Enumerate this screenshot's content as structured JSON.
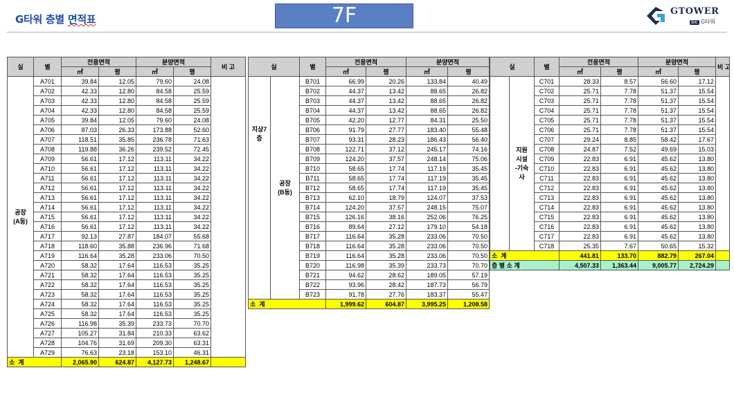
{
  "header": {
    "title_part1": "G타워 층별 ",
    "title_part2": "면적표",
    "floor": "7F",
    "logo_brand": "GTOWER",
    "logo_badge": "BIE",
    "logo_sub": "G타워"
  },
  "columns": {
    "room": "실",
    "unit": "별",
    "exclusive": "전용면적",
    "sale": "분양면적",
    "m2": "㎡",
    "pyeong": "평",
    "remark": "비 고"
  },
  "table_a": {
    "group": "공장\n(A동)",
    "rows": [
      [
        "A701",
        "39.84",
        "12.05",
        "79.60",
        "24.08"
      ],
      [
        "A702",
        "42.33",
        "12.80",
        "84.58",
        "25.59"
      ],
      [
        "A703",
        "42.33",
        "12.80",
        "84.58",
        "25.59"
      ],
      [
        "A704",
        "42.33",
        "12.80",
        "84.58",
        "25.59"
      ],
      [
        "A705",
        "39.84",
        "12.05",
        "79.60",
        "24.08"
      ],
      [
        "A706",
        "87.03",
        "26.33",
        "173.88",
        "52.60"
      ],
      [
        "A707",
        "118.51",
        "35.85",
        "236.78",
        "71.63"
      ],
      [
        "A708",
        "119.88",
        "36.26",
        "239.52",
        "72.45"
      ],
      [
        "A709",
        "56.61",
        "17.12",
        "113.11",
        "34.22"
      ],
      [
        "A710",
        "56.61",
        "17.12",
        "113.11",
        "34.22"
      ],
      [
        "A711",
        "56.61",
        "17.12",
        "113.11",
        "34.22"
      ],
      [
        "A712",
        "56.61",
        "17.12",
        "113.11",
        "34.22"
      ],
      [
        "A713",
        "56.61",
        "17.12",
        "113.11",
        "34.22"
      ],
      [
        "A714",
        "56.61",
        "17.12",
        "113.11",
        "34.22"
      ],
      [
        "A715",
        "56.61",
        "17.12",
        "113.11",
        "34.22"
      ],
      [
        "A716",
        "56.61",
        "17.12",
        "113.11",
        "34.22"
      ],
      [
        "A717",
        "92.13",
        "27.87",
        "184.07",
        "55.68"
      ],
      [
        "A718",
        "118.60",
        "35.88",
        "236.96",
        "71.68"
      ],
      [
        "A719",
        "116.64",
        "35.28",
        "233.06",
        "70.50"
      ],
      [
        "A720",
        "58.32",
        "17.64",
        "116.53",
        "35.25"
      ],
      [
        "A721",
        "58.32",
        "17.64",
        "116.53",
        "35.25"
      ],
      [
        "A722",
        "58.32",
        "17.64",
        "116.53",
        "35.25"
      ],
      [
        "A723",
        "58.32",
        "17.64",
        "116.53",
        "35.25"
      ],
      [
        "A724",
        "58.32",
        "17.64",
        "116.53",
        "35.25"
      ],
      [
        "A725",
        "58.32",
        "17.64",
        "116.53",
        "35.25"
      ],
      [
        "A726",
        "116.98",
        "35.39",
        "233.73",
        "70.70"
      ],
      [
        "A727",
        "105.27",
        "31.84",
        "210.33",
        "63.62"
      ],
      [
        "A728",
        "104.76",
        "31.69",
        "209.30",
        "63.31"
      ],
      [
        "A729",
        "76.63",
        "23.18",
        "153.10",
        "46.31"
      ]
    ],
    "subtotal_label": "소  계",
    "subtotal": [
      "2,065.90",
      "624.87",
      "4,127.73",
      "1,248.67"
    ]
  },
  "table_b": {
    "floor_label": "지상7\n층",
    "group": "공장\n(B동)",
    "rows": [
      [
        "B701",
        "66.99",
        "20.26",
        "133.84",
        "40.49"
      ],
      [
        "B702",
        "44.37",
        "13.42",
        "88.65",
        "26.82"
      ],
      [
        "B703",
        "44.37",
        "13.42",
        "88.65",
        "26.82"
      ],
      [
        "B704",
        "44.37",
        "13.42",
        "88.65",
        "26.82"
      ],
      [
        "B705",
        "42.20",
        "12.77",
        "84.31",
        "25.50"
      ],
      [
        "B706",
        "91.79",
        "27.77",
        "183.40",
        "55.48"
      ],
      [
        "B707",
        "93.31",
        "28.23",
        "186.43",
        "56.40"
      ],
      [
        "B708",
        "122.71",
        "37.12",
        "245.17",
        "74.16"
      ],
      [
        "B709",
        "124.20",
        "37.57",
        "248.14",
        "75.06"
      ],
      [
        "B710",
        "58.65",
        "17.74",
        "117.19",
        "35.45"
      ],
      [
        "B711",
        "58.65",
        "17.74",
        "117.19",
        "35.45"
      ],
      [
        "B712",
        "58.65",
        "17.74",
        "117.19",
        "35.45"
      ],
      [
        "B713",
        "62.10",
        "18.79",
        "124.07",
        "37.53"
      ],
      [
        "B714",
        "124.20",
        "37.57",
        "248.15",
        "75.07"
      ],
      [
        "B715",
        "126.16",
        "38.16",
        "252.06",
        "76.25"
      ],
      [
        "B716",
        "89.64",
        "27.12",
        "179.10",
        "54.18"
      ],
      [
        "B717",
        "116.64",
        "35.28",
        "233.06",
        "70.50"
      ],
      [
        "B718",
        "116.64",
        "35.28",
        "233.06",
        "70.50"
      ],
      [
        "B719",
        "116.64",
        "35.28",
        "233.06",
        "70.50"
      ],
      [
        "B720",
        "116.98",
        "35.39",
        "233.73",
        "70.70"
      ],
      [
        "B721",
        "94.62",
        "28.62",
        "189.05",
        "57.19"
      ],
      [
        "B722",
        "93.96",
        "28.42",
        "187.73",
        "56.79"
      ],
      [
        "B723",
        "91.78",
        "27.76",
        "183.37",
        "55.47"
      ]
    ],
    "subtotal_label": "소  계",
    "subtotal": [
      "1,999.62",
      "604.87",
      "3,995.25",
      "1,208.58"
    ]
  },
  "table_c": {
    "group": "지원\n시설\n-기숙\n사",
    "rows": [
      [
        "C701",
        "28.33",
        "8.57",
        "56.60",
        "17.12"
      ],
      [
        "C702",
        "25.71",
        "7.78",
        "51.37",
        "15.54"
      ],
      [
        "C703",
        "25.71",
        "7.78",
        "51.37",
        "15.54"
      ],
      [
        "C704",
        "25.71",
        "7.78",
        "51.37",
        "15.54"
      ],
      [
        "C705",
        "25.71",
        "7.78",
        "51.37",
        "15.54"
      ],
      [
        "C706",
        "25.71",
        "7.78",
        "51.37",
        "15.54"
      ],
      [
        "C707",
        "29.24",
        "8.85",
        "58.42",
        "17.67"
      ],
      [
        "C708",
        "24.87",
        "7.52",
        "49.69",
        "15.03"
      ],
      [
        "C709",
        "22.83",
        "6.91",
        "45.62",
        "13.80"
      ],
      [
        "C710",
        "22.83",
        "6.91",
        "45.62",
        "13.80"
      ],
      [
        "C711",
        "22.83",
        "6.91",
        "45.62",
        "13.80"
      ],
      [
        "C712",
        "22.83",
        "6.91",
        "45.62",
        "13.80"
      ],
      [
        "C713",
        "22.83",
        "6.91",
        "45.62",
        "13.80"
      ],
      [
        "C714",
        "22.83",
        "6.91",
        "45.62",
        "13.80"
      ],
      [
        "C715",
        "22.83",
        "6.91",
        "45.62",
        "13.80"
      ],
      [
        "C716",
        "22.83",
        "6.91",
        "45.62",
        "13.80"
      ],
      [
        "C717",
        "22.83",
        "6.91",
        "45.62",
        "13.80"
      ],
      [
        "C718",
        "25.35",
        "7.67",
        "50.65",
        "15.32"
      ]
    ],
    "subtotal_label": "소  계",
    "subtotal": [
      "441.81",
      "133.70",
      "882.79",
      "267.04"
    ],
    "total_label": "층 별 소 계",
    "total": [
      "4,507.33",
      "1,363.44",
      "9,005.77",
      "2,724.29"
    ]
  },
  "colors": {
    "title": "#1f4fa6",
    "floor_box": "#5b7fc4",
    "header_bg": "#d0d0d0",
    "subtotal_bg": "#ffff00",
    "total_bg": "#a8f0c8"
  }
}
